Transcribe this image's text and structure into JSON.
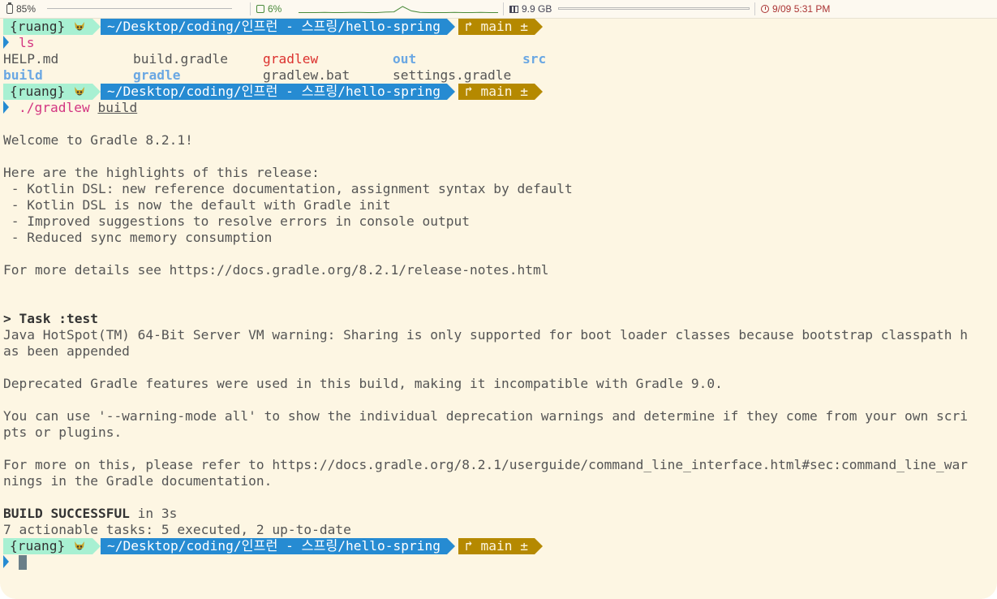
{
  "status_bar": {
    "battery": "85%",
    "cpu": "6%",
    "memory": "9.9 GB",
    "clock": "9/09 5:31 PM",
    "cpu_history": [
      0.05,
      0.05,
      0.05,
      0.06,
      0.05,
      0.05,
      0.06,
      0.06,
      0.05,
      0.05,
      0.07,
      0.08,
      0.3,
      0.12,
      0.06,
      0.05,
      0.05,
      0.05,
      0.06,
      0.05,
      0.05,
      0.06,
      0.05,
      0.05
    ]
  },
  "prompt": {
    "user": "{ruang}",
    "path": "~/Desktop/coding/인프런 - 스프링/hello-spring",
    "git_branch": "main",
    "git_dirty": "±",
    "branch_icon": "git-branch-icon"
  },
  "commands": {
    "first": "ls",
    "second_cmd": "./gradlew",
    "second_arg": "build"
  },
  "ls_output": [
    [
      "HELP.md",
      "build.gradle",
      "gradlew",
      "out",
      "src"
    ],
    [
      "build",
      "gradle",
      "gradlew.bat",
      "settings.gradle"
    ]
  ],
  "output": {
    "welcome": "Welcome to Gradle 8.2.1!",
    "highlights_title": "Here are the highlights of this release:",
    "highlights": [
      " - Kotlin DSL: new reference documentation, assignment syntax by default",
      " - Kotlin DSL is now the default with Gradle init",
      " - Improved suggestions to resolve errors in console output",
      " - Reduced sync memory consumption"
    ],
    "details": "For more details see https://docs.gradle.org/8.2.1/release-notes.html",
    "task": "> Task :test",
    "java_warning_1": "Java HotSpot(TM) 64-Bit Server VM warning: Sharing is only supported for boot loader classes because bootstrap classpath h",
    "java_warning_2": "as been appended",
    "deprecated": "Deprecated Gradle features were used in this build, making it incompatible with Gradle 9.0.",
    "warning_mode_1": "You can use '--warning-mode all' to show the individual deprecation warnings and determine if they come from your own scri",
    "warning_mode_2": "pts or plugins.",
    "refer_1": "For more on this, please refer to https://docs.gradle.org/8.2.1/userguide/command_line_interface.html#sec:command_line_war",
    "refer_2": "nings in the Gradle documentation.",
    "build_status": "BUILD SUCCESSFUL",
    "build_time": " in 3s",
    "tasks": "7 actionable tasks: 5 executed, 2 up-to-date"
  }
}
